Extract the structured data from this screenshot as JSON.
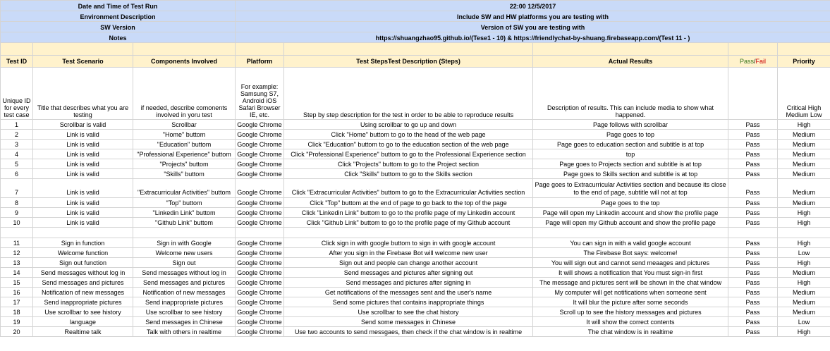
{
  "meta": [
    {
      "label": "Date and Time of Test Run",
      "value": "22:00 12/5/2017"
    },
    {
      "label": "Environment Description",
      "value": "Include SW and HW platforms you are testing with"
    },
    {
      "label": "SW Version",
      "value": "Version of SW you are testing with"
    },
    {
      "label": "Notes",
      "value": "https://shuangzhao95.github.io/(Tese1 - 10) & https://friendlychat-by-shuang.firebaseapp.com/(Test 11 - )"
    }
  ],
  "headers": {
    "test_id": "Test ID",
    "scenario": "Test Scenario",
    "components": "Components Involved",
    "platform": "Platform",
    "steps": "Test StepsTest Description (Steps)",
    "actual": "Actual Results",
    "pass": "Pass",
    "slash": "/",
    "fail": "Fail",
    "priority": "Priority"
  },
  "descriptions": {
    "test_id": "Unique ID for every test case",
    "scenario": "Title that describes what you are testing",
    "components": "if needed, describe comonents involved in yoru test",
    "platform": "For example: Samsung S7, Android iOS Safari Browser IE, etc.",
    "steps": "Step by step description for the test in order to be able to reproduce results",
    "actual": "Description of results.  This can include media to show what happened.",
    "pass": "",
    "priority": "Critical High Medium Low"
  },
  "rows_a": [
    {
      "id": "1",
      "scenario": "Scrollbar is valid",
      "components": "Scrollbar",
      "platform": "Google Chrome",
      "steps": "Using scrollbar to go up and down",
      "actual": "Page follows with scrollbar",
      "pass": "Pass",
      "priority": "High"
    },
    {
      "id": "2",
      "scenario": "Link is valid",
      "components": "\"Home\" buttom",
      "platform": "Google Chrome",
      "steps": "Click \"Home\" buttom to go to the head of the web page",
      "actual": "Page goes to top",
      "pass": "Pass",
      "priority": "Medium"
    },
    {
      "id": "3",
      "scenario": "Link is valid",
      "components": "\"Education\" buttom",
      "platform": "Google Chrome",
      "steps": "Click \"Education\" buttom to go to the education section of the web page",
      "actual": "Page goes to education section and subtitle is at top",
      "pass": "Pass",
      "priority": "Medium"
    },
    {
      "id": "4",
      "scenario": "Link is valid",
      "components": "\"Professional Experience\" buttom",
      "platform": "Google Chrome",
      "steps": "Click \"Professional Experience\" buttom to go to the Professional Experience section",
      "actual": "top",
      "pass": "Pass",
      "priority": "Medium"
    },
    {
      "id": "5",
      "scenario": "Link is valid",
      "components": "\"Projects\" buttom",
      "platform": "Google Chrome",
      "steps": "Click \"Projects\" buttom to go to the Project section",
      "actual": "Page goes to Projects section and subtitle is at top",
      "pass": "Pass",
      "priority": "Medium"
    },
    {
      "id": "6",
      "scenario": "Link is valid",
      "components": "\"Skills\" buttom",
      "platform": "Google Chrome",
      "steps": "Click \"Skills\" buttom to go to the Skills section",
      "actual": "Page goes to Skills section and subtitle is at top",
      "pass": "Pass",
      "priority": "Medium"
    }
  ],
  "row7": {
    "id": "7",
    "scenario": "Link is valid",
    "components": "\"Extracurricular Activities\" buttom",
    "platform": "Google Chrome",
    "steps": "Click \"Extracurricular Activities\" buttom to go to the Extracurricular Activities section",
    "actual": "Page goes to Extracurricular Activities section and because its close to the end of page, subtitle will not at top",
    "pass": "Pass",
    "priority": "Medium"
  },
  "rows_b": [
    {
      "id": "8",
      "scenario": "Link is valid",
      "components": "\"Top\" buttom",
      "platform": "Google Chrome",
      "steps": "Click \"Top\" buttom at the end of page to go back to the top of the page",
      "actual": "Page goes to the top",
      "pass": "Pass",
      "priority": "Medium"
    },
    {
      "id": "9",
      "scenario": "Link is valid",
      "components": "\"Linkedin Link\" buttom",
      "platform": "Google Chrome",
      "steps": "Click \"Linkedin Link\" buttom to go to the profile page of my Linkedin account",
      "actual": "Page will open my Linkedin account and show the profile page",
      "pass": "Pass",
      "priority": "High"
    },
    {
      "id": "10",
      "scenario": "Link is valid",
      "components": "\"Github Link\" buttom",
      "platform": "Google Chrome",
      "steps": "Click \"Github Link\" buttom to go to the profile page of my Github account",
      "actual": "Page will open my Github account and show the profile page",
      "pass": "Pass",
      "priority": "High"
    }
  ],
  "rows_c": [
    {
      "id": "11",
      "scenario": "Sign in function",
      "components": "Sign in with Google",
      "platform": "Google Chrome",
      "steps": "Click sign in with google buttom to sign in with google account",
      "actual": "You can sign in with a valid google account",
      "pass": "Pass",
      "priority": "High"
    },
    {
      "id": "12",
      "scenario": "Welcome function",
      "components": "Welcome new users",
      "platform": "Google Chrome",
      "steps": "After you sign in the Firebase Bot will welcome new user",
      "actual": "The Firebase Bot says: welcome!",
      "pass": "Pass",
      "priority": "Low"
    },
    {
      "id": "13",
      "scenario": "Sign out function",
      "components": "Sign out",
      "platform": "Google Chrome",
      "steps": "Sign out and people can change another account",
      "actual": "You will sign out and cannot send meaages and pictures",
      "pass": "Pass",
      "priority": "High"
    },
    {
      "id": "14",
      "scenario": "Send messages without log in",
      "components": "Send messages without log in",
      "platform": "Google Chrome",
      "steps": "Send messages and pictures after signing out",
      "actual": "It will shows a notification that You must sign-in first",
      "pass": "Pass",
      "priority": "Medium"
    },
    {
      "id": "15",
      "scenario": "Send messages and pictures",
      "components": "Send messages and pictures",
      "platform": "Google Chrome",
      "steps": "Send messages and pictures after signing in",
      "actual": "The message and pictures sent will be shown in the chat window",
      "pass": "Pass",
      "priority": "High"
    },
    {
      "id": "16",
      "scenario": "Notification of new messages",
      "components": "Notification of new messages",
      "platform": "Google Chrome",
      "steps": "Get notifications of the messages sent and the user's name",
      "actual": "My computer will get notifications when someone sent",
      "pass": "Pass",
      "priority": "Medium"
    },
    {
      "id": "17",
      "scenario": "Send inappropriate pictures",
      "components": "Send inappropriate pictures",
      "platform": "Google Chrome",
      "steps": "Send some pictures that contains inappropriate things",
      "actual": "It will blur the picture after some seconds",
      "pass": "Pass",
      "priority": "Medium"
    },
    {
      "id": "18",
      "scenario": "Use scrollbar to see history",
      "components": "Use scrollbar to see history",
      "platform": "Google Chrome",
      "steps": "Use scrollbar to see the chat history",
      "actual": "Scroll up to see the history messages and pictures",
      "pass": "Pass",
      "priority": "Medium"
    },
    {
      "id": "19",
      "scenario": "language",
      "components": "Send messages in Chinese",
      "platform": "Google Chrome",
      "steps": "Send some messages in Chinese",
      "actual": "It will show the correct contents",
      "pass": "Pass",
      "priority": "Low"
    },
    {
      "id": "20",
      "scenario": "Realtime talk",
      "components": "Talk with others in realtime",
      "platform": "Google Chrome",
      "steps": "Use two accounts to send messgaes, then check if the chat window is in realtime",
      "actual": "The chat window is in realtime",
      "pass": "Pass",
      "priority": "High"
    }
  ],
  "colors": {
    "meta_bg": "#c9daf8",
    "header_bg": "#fff2cc",
    "pass": "#38761d",
    "fail": "#cc0000"
  }
}
